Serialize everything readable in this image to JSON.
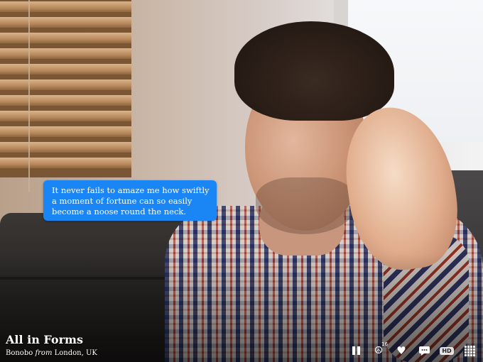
{
  "quote": {
    "text": "It never fails to amaze me how swiftly a moment of fortune can so easily become a noose round the neck."
  },
  "track": {
    "title": "All in Forms",
    "artist": "Bonobo",
    "from_word": "from",
    "location": "London, UK"
  },
  "toolbar": {
    "peace_count": "16",
    "hd_label": "HD",
    "icons": [
      "pause-icon",
      "peace-icon",
      "heart-icon",
      "comment-icon",
      "hd-icon",
      "grid-icon"
    ]
  }
}
